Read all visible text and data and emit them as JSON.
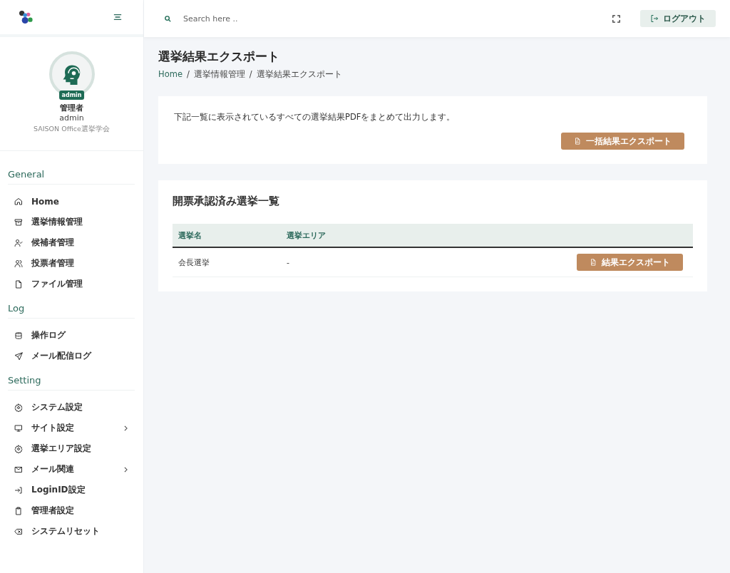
{
  "topbar": {
    "search": {
      "placeholder": "Search here .."
    },
    "logout": "ログアウト"
  },
  "profile": {
    "badge": "admin",
    "name": "管理者",
    "username": "admin",
    "organization": "SAISON Office選挙学会"
  },
  "sidebar": {
    "sections": [
      {
        "title": "General",
        "items": [
          {
            "label": "Home",
            "has_submenu": false
          },
          {
            "label": "選挙情報管理",
            "has_submenu": false
          },
          {
            "label": "候補者管理",
            "has_submenu": false
          },
          {
            "label": "投票者管理",
            "has_submenu": false
          },
          {
            "label": "ファイル管理",
            "has_submenu": false
          }
        ]
      },
      {
        "title": "Log",
        "items": [
          {
            "label": "操作ログ",
            "has_submenu": false
          },
          {
            "label": "メール配信ログ",
            "has_submenu": false
          }
        ]
      },
      {
        "title": "Setting",
        "items": [
          {
            "label": "システム設定",
            "has_submenu": false
          },
          {
            "label": "サイト設定",
            "has_submenu": true
          },
          {
            "label": "選挙エリア設定",
            "has_submenu": false
          },
          {
            "label": "メール関連",
            "has_submenu": true
          },
          {
            "label": "LoginID設定",
            "has_submenu": false
          },
          {
            "label": "管理者設定",
            "has_submenu": false
          },
          {
            "label": "システムリセット",
            "has_submenu": false
          }
        ]
      }
    ]
  },
  "page": {
    "title": "選挙結果エクスポート",
    "breadcrumb_separator": "/",
    "breadcrumb": [
      {
        "label": "Home",
        "link": true
      },
      {
        "label": "選挙情報管理",
        "link": false
      },
      {
        "label": "選挙結果エクスポート",
        "link": false
      }
    ]
  },
  "export_card": {
    "description": "下記一覧に表示されているすべての選挙結果PDFをまとめて出力します。",
    "button": "一括結果エクスポート"
  },
  "table_card": {
    "title": "開票承認済み選挙一覧",
    "columns": [
      "選挙名",
      "選挙エリア"
    ],
    "rows": [
      {
        "name": "会長選挙",
        "area": "-",
        "button": "結果エクスポート"
      }
    ]
  }
}
